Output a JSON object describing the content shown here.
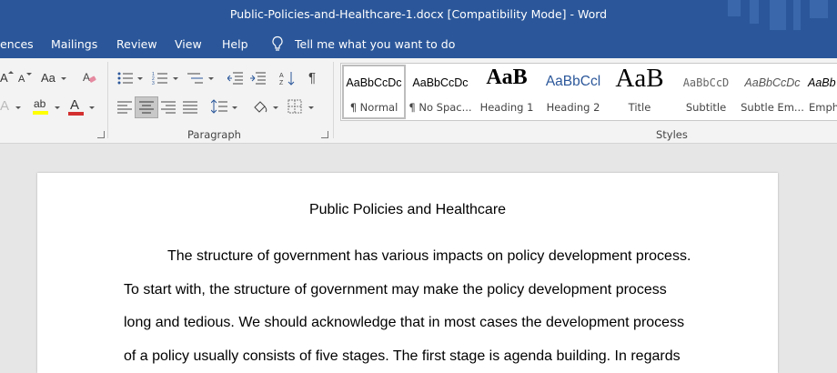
{
  "window": {
    "title": "Public-Policies-and-Healthcare-1.docx [Compatibility Mode]  -  Word"
  },
  "menu": {
    "items": [
      "ences",
      "Mailings",
      "Review",
      "View",
      "Help"
    ],
    "tell_me": "Tell me what you want to do"
  },
  "ribbon": {
    "groups": {
      "paragraph": "Paragraph",
      "styles": "Styles"
    },
    "font_row1": {
      "grow": "A",
      "shrink": "A",
      "case": "Aa"
    },
    "font_row2": {
      "effects": "A",
      "highlight": "ab",
      "color": "A"
    },
    "colors": {
      "highlight": "#ffff00",
      "font_color": "#d32f2f",
      "accent": "#2b579a"
    },
    "styles": [
      {
        "sample": "AaBbCcDc",
        "name": "¶ Normal"
      },
      {
        "sample": "AaBbCcDc",
        "name": "¶ No Spac..."
      },
      {
        "sample": "AaB",
        "name": "Heading 1"
      },
      {
        "sample": "AaBbCcl",
        "name": "Heading 2"
      },
      {
        "sample": "AaB",
        "name": "Title"
      },
      {
        "sample": "AaBbCcD",
        "name": "Subtitle"
      },
      {
        "sample": "AaBbCcDc",
        "name": "Subtle Em..."
      },
      {
        "sample": "AaBb",
        "name": "Emph"
      }
    ]
  },
  "document": {
    "title": "Public Policies and Healthcare",
    "lines": [
      "The structure of government has various impacts on policy development process.",
      "To start with, the structure of government may make the policy development process",
      "long and tedious. We should acknowledge that in most cases the development process",
      "of a policy usually consists of five stages. The first stage is agenda building. In regards"
    ]
  }
}
